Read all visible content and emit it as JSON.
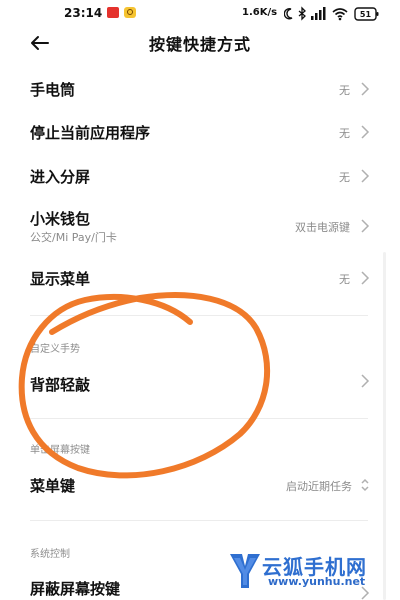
{
  "status_bar": {
    "time": "23:14",
    "network_speed": "1.6K/s",
    "battery": "51"
  },
  "header": {
    "title": "按键快捷方式"
  },
  "rows": [
    {
      "title": "手电筒",
      "value": "无"
    },
    {
      "title": "停止当前应用程序",
      "value": "无"
    },
    {
      "title": "进入分屏",
      "value": "无"
    },
    {
      "title": "小米钱包",
      "subtitle": "公交/Mi Pay/门卡",
      "value": "双击电源键"
    },
    {
      "title": "显示菜单",
      "value": "无"
    }
  ],
  "sections": {
    "custom_gesture": {
      "header": "自定义手势",
      "back_tap": {
        "title": "背部轻敲"
      }
    },
    "single_tap": {
      "header": "单击屏幕按键",
      "menu_key": {
        "title": "菜单键",
        "value": "启动近期任务"
      }
    },
    "system_control": {
      "header": "系统控制",
      "block_keys": {
        "title": "屏蔽屏幕按键"
      }
    }
  },
  "watermark": {
    "name": "云狐手机网",
    "url": "www.yunhu.net"
  },
  "colors": {
    "annotation_stroke": "#f07a2a",
    "watermark_blue": "#2f6fd0"
  }
}
